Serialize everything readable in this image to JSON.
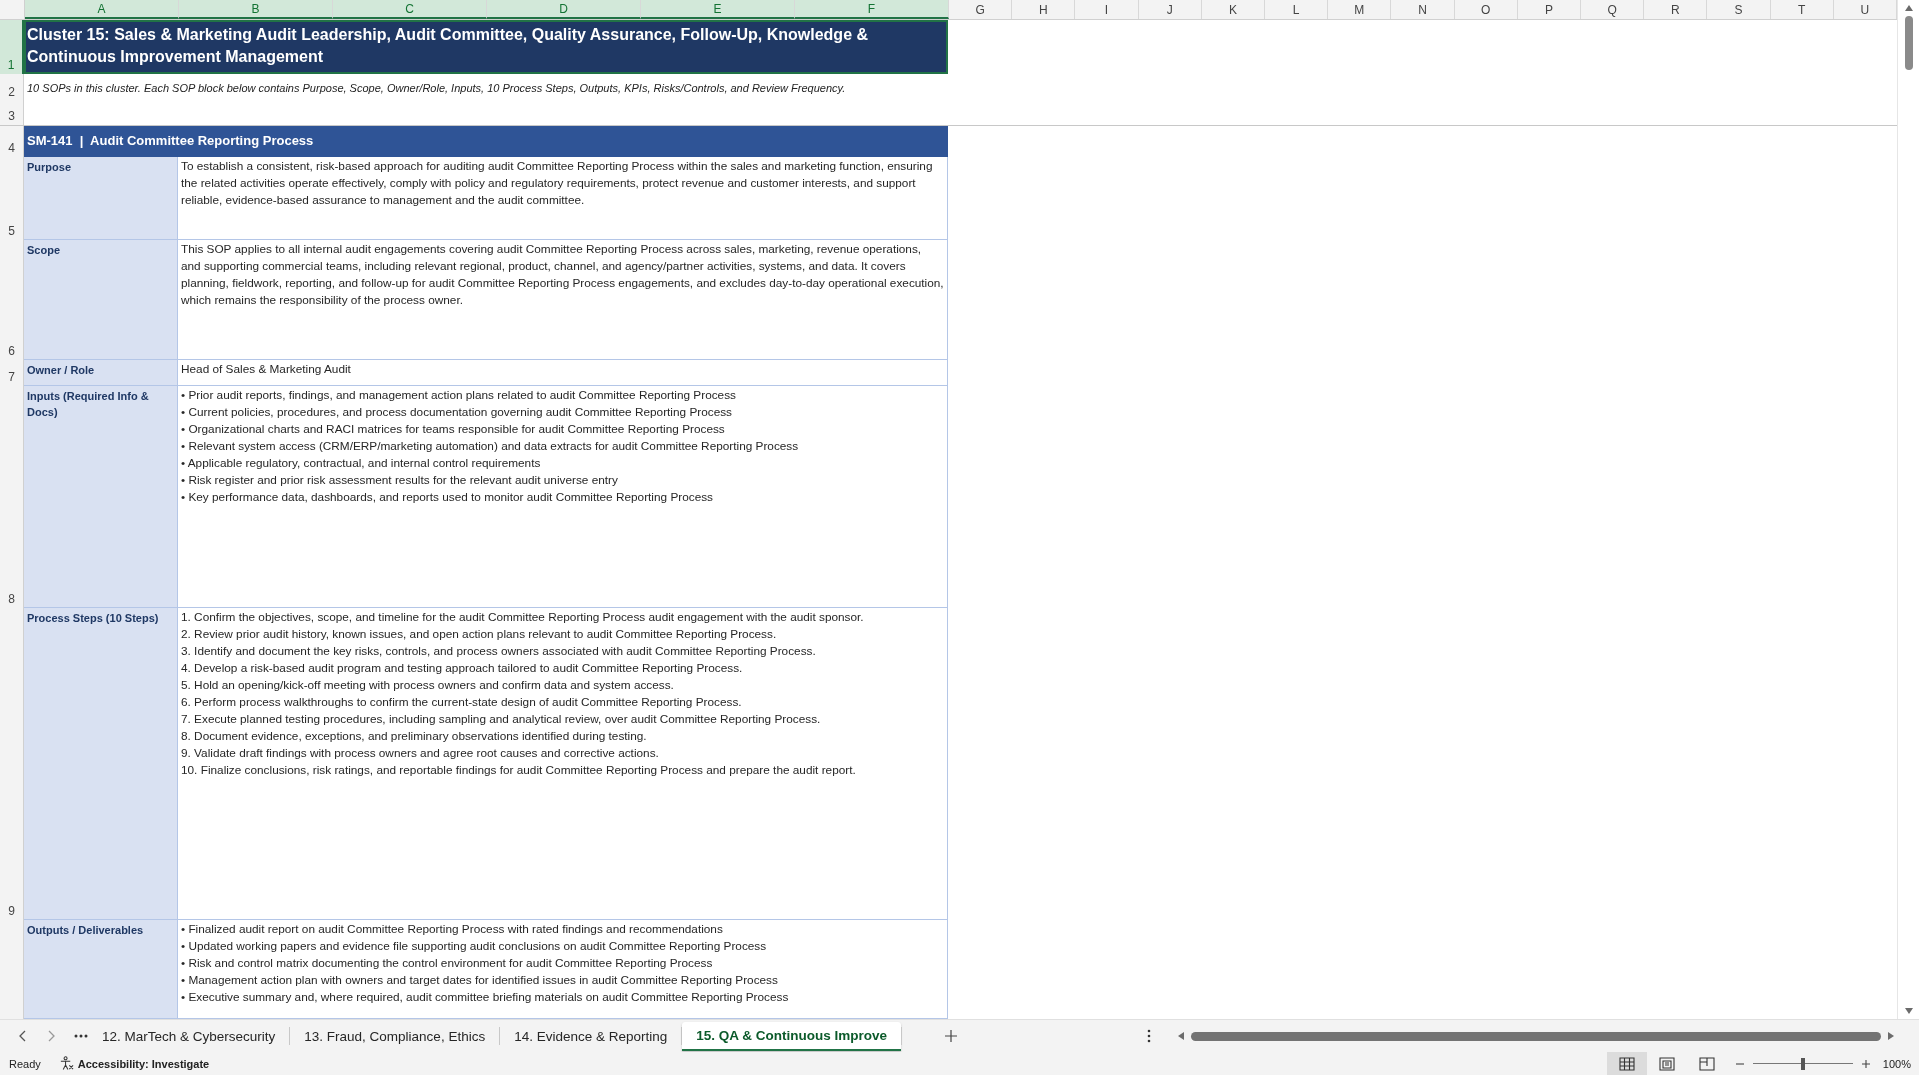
{
  "column_headers": [
    {
      "label": "A",
      "selected": true
    },
    {
      "label": "B",
      "selected": true
    },
    {
      "label": "C",
      "selected": true
    },
    {
      "label": "D",
      "selected": true
    },
    {
      "label": "E",
      "selected": true
    },
    {
      "label": "F",
      "selected": true
    },
    {
      "label": "G",
      "selected": false
    },
    {
      "label": "H",
      "selected": false
    },
    {
      "label": "I",
      "selected": false
    },
    {
      "label": "J",
      "selected": false
    },
    {
      "label": "K",
      "selected": false
    },
    {
      "label": "L",
      "selected": false
    },
    {
      "label": "M",
      "selected": false
    },
    {
      "label": "N",
      "selected": false
    },
    {
      "label": "O",
      "selected": false
    },
    {
      "label": "P",
      "selected": false
    },
    {
      "label": "Q",
      "selected": false
    },
    {
      "label": "R",
      "selected": false
    },
    {
      "label": "S",
      "selected": false
    },
    {
      "label": "T",
      "selected": false
    },
    {
      "label": "U",
      "selected": false
    }
  ],
  "title_row": {
    "row": "1",
    "selected": true,
    "text": "Cluster 15: Sales & Marketing Audit Leadership, Audit Committee, Quality Assurance, Follow-Up, Knowledge & Continuous Improvement Management"
  },
  "note_row": {
    "row": "2",
    "text": "10 SOPs in this cluster. Each SOP block below contains Purpose, Scope, Owner/Role, Inputs, 10 Process Steps, Outputs, KPIs, Risks/Controls, and Review Frequency."
  },
  "blank_row": {
    "row": "3"
  },
  "sop_header": {
    "row": "4",
    "text": "SM-141  |  Audit Committee Reporting Process"
  },
  "fields": [
    {
      "row": "5",
      "label": "Purpose",
      "kind": "text",
      "text": "To establish a consistent, risk-based approach for auditing audit Committee Reporting Process within the sales and marketing function, ensuring the related activities operate effectively, comply with policy and regulatory requirements, protect revenue and customer interests, and support reliable, evidence-based assurance to management and the audit committee."
    },
    {
      "row": "6",
      "label": "Scope",
      "kind": "text",
      "text": "This SOP applies to all internal audit engagements covering audit Committee Reporting Process across sales, marketing, revenue operations, and supporting commercial teams, including relevant regional, product, channel, and agency/partner activities, systems, and data. It covers planning, fieldwork, reporting, and follow-up for audit Committee Reporting Process engagements, and excludes day-to-day operational execution, which remains the responsibility of the process owner."
    },
    {
      "row": "7",
      "label": "Owner / Role",
      "kind": "text",
      "text": "Head of Sales & Marketing Audit"
    },
    {
      "row": "8",
      "label": "Inputs (Required Info & Docs)",
      "kind": "list",
      "items": [
        "• Prior audit reports, findings, and management action plans related to audit Committee Reporting Process",
        "• Current policies, procedures, and process documentation governing audit Committee Reporting Process",
        "• Organizational charts and RACI matrices for teams responsible for audit Committee Reporting Process",
        "• Relevant system access (CRM/ERP/marketing automation) and data extracts for audit Committee Reporting Process",
        "• Applicable regulatory, contractual, and internal control requirements",
        "• Risk register and prior risk assessment results for the relevant audit universe entry",
        "• Key performance data, dashboards, and reports used to monitor audit Committee Reporting Process"
      ]
    },
    {
      "row": "9",
      "label": "Process Steps (10 Steps)",
      "kind": "list",
      "items": [
        "1. Confirm the objectives, scope, and timeline for the audit Committee Reporting Process audit engagement with the audit sponsor.",
        "2. Review prior audit history, known issues, and open action plans relevant to audit Committee Reporting Process.",
        "3. Identify and document the key risks, controls, and process owners associated with audit Committee Reporting Process.",
        "4. Develop a risk-based audit program and testing approach tailored to audit Committee Reporting Process.",
        "5. Hold an opening/kick-off meeting with process owners and confirm data and system access.",
        "6. Perform process walkthroughs to confirm the current-state design of audit Committee Reporting Process.",
        "7. Execute planned testing procedures, including sampling and analytical review, over audit Committee Reporting Process.",
        "8. Document evidence, exceptions, and preliminary observations identified during testing.",
        "9. Validate draft findings with process owners and agree root causes and corrective actions.",
        "10. Finalize conclusions, risk ratings, and reportable findings for audit Committee Reporting Process and prepare the audit report."
      ]
    },
    {
      "label": "Outputs / Deliverables",
      "kind": "list",
      "items": [
        "• Finalized audit report on audit Committee Reporting Process with rated findings and recommendations",
        "• Updated working papers and evidence file supporting audit conclusions on audit Committee Reporting Process",
        "• Risk and control matrix documenting the control environment for audit Committee Reporting Process",
        "• Management action plan with owners and target dates for identified issues in audit Committee Reporting Process",
        "• Executive summary and, where required, audit committee briefing materials on audit Committee Reporting Process"
      ]
    }
  ],
  "sheet_tabs": [
    {
      "label": "12. MarTech & Cybersecurity",
      "selected": false
    },
    {
      "label": "13. Fraud, Compliance, Ethics",
      "selected": false
    },
    {
      "label": "14. Evidence & Reporting",
      "selected": false
    },
    {
      "label": "15. QA & Continuous Improve",
      "selected": true
    }
  ],
  "status_bar": {
    "status": "Ready",
    "accessibility": "Accessibility: Investigate",
    "zoom": "100%"
  },
  "views": [
    {
      "kind": "normal",
      "selected": true
    },
    {
      "kind": "page-layout",
      "selected": false
    },
    {
      "kind": "page-break",
      "selected": false
    }
  ],
  "zoom_slider": {
    "level": 0.5
  }
}
